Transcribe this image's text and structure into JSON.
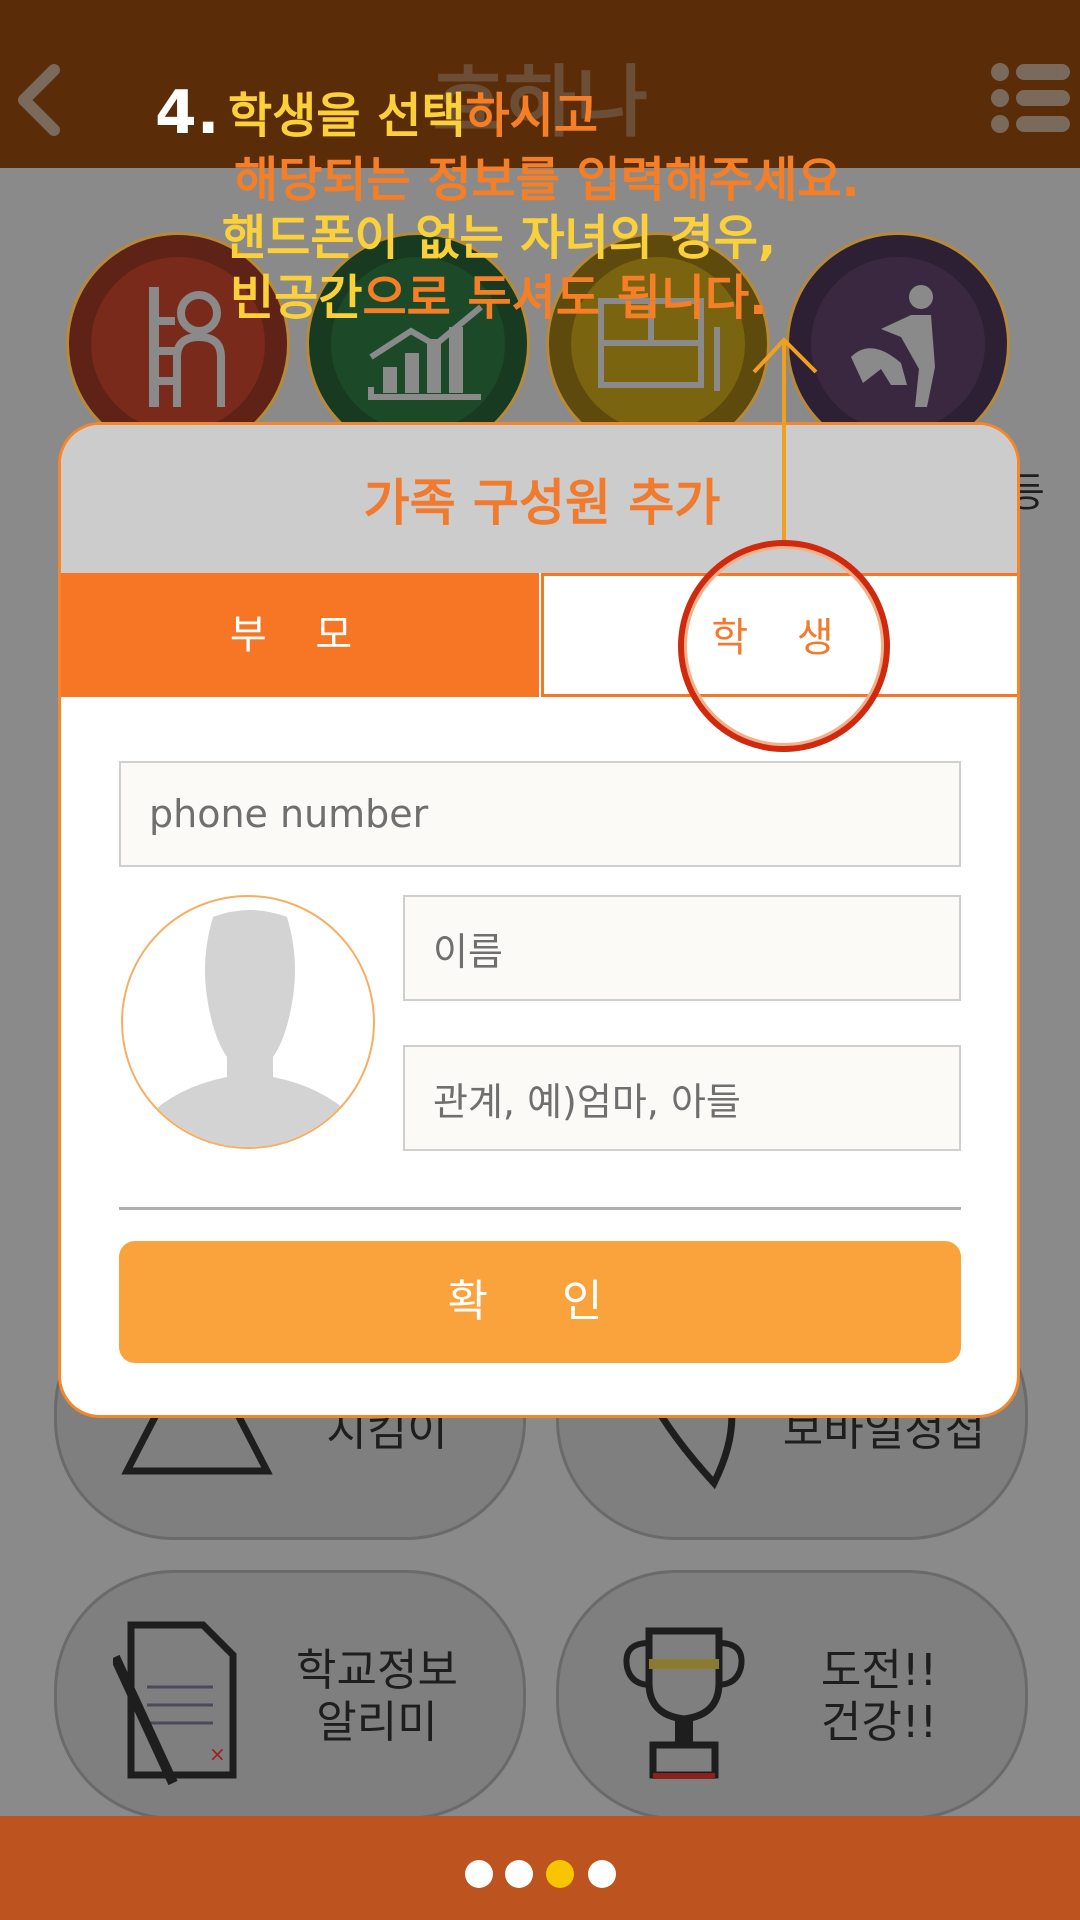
{
  "header": {
    "title": "효하나"
  },
  "categories": [
    {
      "name": "growth",
      "color": "#7a2a1a",
      "icon": "person-growth-icon"
    },
    {
      "name": "chart",
      "color": "#1c4a28",
      "icon": "bar-chart-icon"
    },
    {
      "name": "meal",
      "color": "#7a6410",
      "icon": "meal-tray-icon"
    },
    {
      "name": "exercise",
      "color": "#3a2840",
      "icon": "exercise-icon"
    }
  ],
  "side_partial_text": "등",
  "tiles": [
    {
      "label": "지킴이"
    },
    {
      "label": "보바일청첩"
    },
    {
      "label": "학교정보\n알리미"
    },
    {
      "label": "도전!!\n건강!!"
    }
  ],
  "dialog": {
    "title": "가족 구성원 추가",
    "tabs": [
      {
        "label": "부 모",
        "active": true
      },
      {
        "label": "학 생",
        "active": false
      }
    ],
    "phone_placeholder": "phone number",
    "name_placeholder": "이름",
    "relation_placeholder": "관계, 예)엄마, 아들",
    "confirm_label": "확 인"
  },
  "instruction": {
    "step": "4.",
    "line1_a": "학생을 선택",
    "line1_b": "하시고",
    "line2": "해당되는 정보를 입력해주세요.",
    "line3": "핸드폰이 없는 자녀의 경우,",
    "line4_a": "빈공간",
    "line4_b": "으로 두셔도 됩니다."
  },
  "pager": {
    "count": 4,
    "active_index": 2
  },
  "colors": {
    "header": "#5a2c07",
    "accent": "#f67626",
    "confirm": "#faa33d",
    "footer": "#bd541f",
    "highlight": "#fbd13b"
  }
}
